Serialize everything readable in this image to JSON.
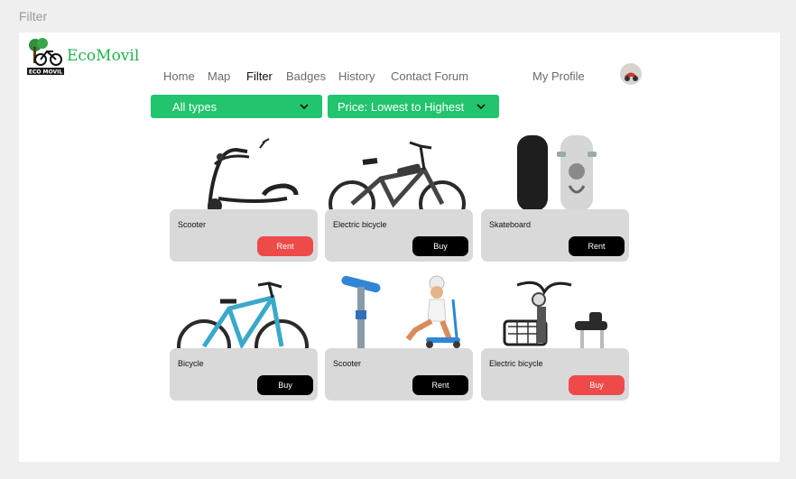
{
  "frame_label": "Filter",
  "brand": {
    "name": "EcoMovil",
    "logo_text": "ECO MOVIL",
    "color": "#22b24c"
  },
  "nav": {
    "items": [
      "Home",
      "Map",
      "Filter",
      "Badges",
      "History",
      "Contact Forum"
    ],
    "active": "Filter",
    "profile": "My Profile"
  },
  "filters": {
    "type": "All types",
    "sort": "Price: Lowest to Highest",
    "color": "#22c46d"
  },
  "products": [
    {
      "name": "Scooter",
      "action": "Rent",
      "action_color": "#ef4a4a",
      "icon": "e-scooter-photo"
    },
    {
      "name": "Electric bicycle",
      "action": "Buy",
      "action_color": "#000000",
      "icon": "electric-bicycle-photo"
    },
    {
      "name": "Skateboard",
      "action": "Rent",
      "action_color": "#000000",
      "icon": "skateboard-photo"
    },
    {
      "name": "Bicycle",
      "action": "Buy",
      "action_color": "#000000",
      "icon": "bicycle-photo"
    },
    {
      "name": "Scooter",
      "action": "Rent",
      "action_color": "#000000",
      "icon": "kick-scooter-photo"
    },
    {
      "name": "Electric bicycle",
      "action": "Buy",
      "action_color": "#ef4a4a",
      "icon": "electric-moped-photo"
    }
  ]
}
